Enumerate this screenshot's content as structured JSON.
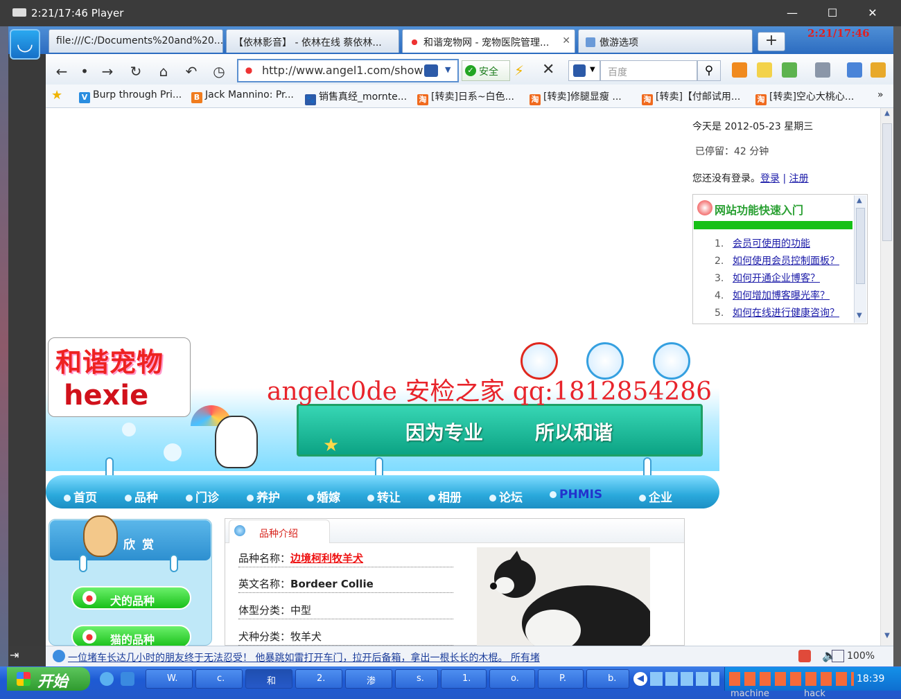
{
  "player": {
    "title": "2:21/17:46 Player",
    "overlay_time": "2:21/17:46",
    "min": "—",
    "max": "☐",
    "close": "✕"
  },
  "browser": {
    "tabs": [
      {
        "label": "file:///C:/Documents%20and%20...",
        "active": false
      },
      {
        "label": "【依林影音】 - 依林在线 蔡依林...",
        "active": false
      },
      {
        "label": "和谐宠物网 - 宠物医院管理...",
        "active": true
      },
      {
        "label": "傲游选项",
        "active": false
      }
    ],
    "tab_add": "+",
    "url": "http://www.angel1.com/show",
    "safe": "安全",
    "search_placeholder": "百度",
    "bookmarks": [
      {
        "icon": "V",
        "label": "Burp through Pri..."
      },
      {
        "icon": "B",
        "label": "Jack Mannino: Pr..."
      },
      {
        "icon": "🐾",
        "label": "销售真经_mornte..."
      },
      {
        "icon": "淘",
        "label": "[转卖]日系~白色..."
      },
      {
        "icon": "淘",
        "label": "[转卖]修腿显瘦 ..."
      },
      {
        "icon": "淘",
        "label": "[转卖]【付邮试用..."
      },
      {
        "icon": "淘",
        "label": "[转卖]空心大桃心..."
      }
    ],
    "bookmark_more": "»",
    "status_news": "一位堵车长达几小时的朋友终于无法忍受！ 他暴跳如雷打开车门，拉开后备箱，拿出一根长长的木棍。 所有堵",
    "zoom": "100%"
  },
  "site": {
    "date": "今天是 2012-05-23 星期三",
    "stay": "已停留：42 分钟",
    "login_prompt": "您还没有登录。",
    "login": "登录",
    "sep": "|",
    "register": "注册",
    "quick_title": "网站功能快速入门",
    "quick_items": [
      {
        "n": "1.",
        "label": "会员可使用的功能"
      },
      {
        "n": "2.",
        "label": "如何使用会员控制面板？"
      },
      {
        "n": "3.",
        "label": "如何开通企业博客？"
      },
      {
        "n": "4.",
        "label": "如何增加博客曝光率？"
      },
      {
        "n": "5.",
        "label": "如何在线进行健康咨询？"
      }
    ],
    "logo_cn": "和谐宠物",
    "logo_en": "hexie",
    "watermark": "angelc0de 安检之家 qq:1812854286",
    "slogan1": "因为专业",
    "slogan2": "所以和谐",
    "menu": [
      "首页",
      "品种",
      "门诊",
      "养护",
      "婚嫁",
      "转让",
      "相册",
      "论坛",
      "PHMIS",
      "企业"
    ],
    "side_head": "欣赏",
    "side_buttons": [
      "犬的品种",
      "猫的品种"
    ],
    "content_title": "品种介绍",
    "info": [
      {
        "label": "品种名称：",
        "value": "边境柯利牧羊犬"
      },
      {
        "label": "英文名称：",
        "value": "Bordeer Collie"
      },
      {
        "label": "体型分类：",
        "value": "中型"
      },
      {
        "label": "犬种分类：",
        "value": "牧羊犬"
      }
    ]
  },
  "taskbar": {
    "start": "开始",
    "buttons": [
      "W.",
      "c.",
      "和",
      "2.",
      "渗",
      "s.",
      "1.",
      "o.",
      "P.",
      "b."
    ],
    "clock": "18:39",
    "below_left": "machine",
    "below_right": "hack"
  },
  "colors": {
    "accent_blue": "#2c6cc0",
    "menu_cyan": "#2aa9dc",
    "watermark_red": "#e8242b",
    "green": "#16c016"
  }
}
